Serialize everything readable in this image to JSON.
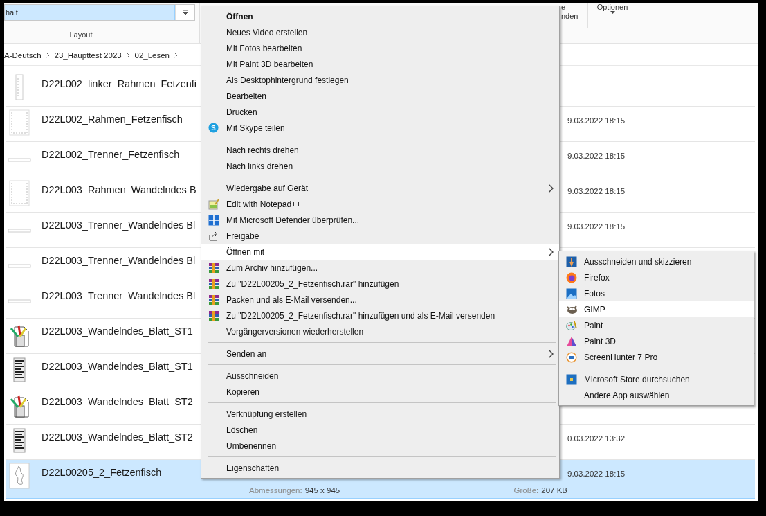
{
  "ribbon": {
    "gallery": {
      "items": [
        {
          "label": "halt",
          "selected": true
        }
      ]
    },
    "group_label": "Layout",
    "partial_button": {
      "lines": [
        "e",
        "nden"
      ]
    },
    "options_button": {
      "label": "Optionen"
    }
  },
  "breadcrumb": [
    "A-Deutsch",
    "23_Haupttest 2023",
    "02_Lesen"
  ],
  "files": [
    {
      "name": "D22L002_linker_Rahmen_Fetzenfi",
      "kind": "frame-tall",
      "selected": false
    },
    {
      "name": "D22L002_Rahmen_Fetzenfisch",
      "date": "9.03.2022 18:15",
      "kind": "frame",
      "selected": false
    },
    {
      "name": "D22L002_Trenner_Fetzenfisch",
      "date": "9.03.2022 18:15",
      "kind": "line",
      "selected": false
    },
    {
      "name": "D22L003_Rahmen_Wandelndes B",
      "date": "9.03.2022 18:15",
      "kind": "frame",
      "selected": false
    },
    {
      "name": "D22L003_Trenner_Wandelndes Bl",
      "date": "9.03.2022 18:15",
      "kind": "line",
      "selected": false
    },
    {
      "name": "D22L003_Trenner_Wandelndes Bl",
      "kind": "line",
      "selected": false
    },
    {
      "name": "D22L003_Trenner_Wandelndes Bl",
      "kind": "line",
      "selected": false
    },
    {
      "name": "D22L003_Wandelndes_Blatt_ST1",
      "kind": "paint",
      "selected": false
    },
    {
      "name": "D22L003_Wandelndes_Blatt_ST1",
      "kind": "doc",
      "selected": false
    },
    {
      "name": "D22L003_Wandelndes_Blatt_ST2",
      "kind": "paint",
      "selected": false
    },
    {
      "name": "D22L003_Wandelndes_Blatt_ST2",
      "date": "0.03.2022 13:32",
      "kind": "doc",
      "selected": false
    },
    {
      "name": "D22L00205_2_Fetzenfisch",
      "date": "9.03.2022 18:15",
      "kind": "figure",
      "selected": true,
      "details": {
        "dimensions_label": "Abmessungen:",
        "dimensions": "945 x 945",
        "size_label": "Größe:",
        "size": "207 KB"
      }
    }
  ],
  "context_menu": {
    "groups": [
      [
        {
          "label": "Öffnen",
          "default": true,
          "highlighted": false
        },
        {
          "label": "Neues Video erstellen",
          "highlighted": false
        },
        {
          "label": "Mit Fotos bearbeiten",
          "highlighted": false
        },
        {
          "label": "Mit Paint 3D bearbeiten",
          "highlighted": false
        },
        {
          "label": "Als Desktophintergrund festlegen",
          "highlighted": false
        },
        {
          "label": "Bearbeiten",
          "highlighted": false
        },
        {
          "label": "Drucken",
          "highlighted": false
        },
        {
          "label": "Mit Skype teilen",
          "kind": "skype",
          "highlighted": false
        }
      ],
      [
        {
          "label": "Nach rechts drehen",
          "highlighted": false
        },
        {
          "label": "Nach links drehen",
          "highlighted": false
        }
      ],
      [
        {
          "label": "Wiedergabe auf Gerät",
          "submenu": true,
          "highlighted": false
        },
        {
          "label": "Edit with Notepad++",
          "kind": "notepad",
          "highlighted": false
        },
        {
          "label": "Mit Microsoft Defender überprüfen...",
          "kind": "defender",
          "highlighted": false
        },
        {
          "label": "Freigabe",
          "kind": "share",
          "highlighted": false
        },
        {
          "label": "Öffnen mit",
          "submenu": true,
          "highlighted": true
        },
        {
          "label": "Zum Archiv hinzufügen...",
          "kind": "archive",
          "highlighted": false
        },
        {
          "label": "Zu \"D22L00205_2_Fetzenfisch.rar\" hinzufügen",
          "kind": "archive",
          "highlighted": false
        },
        {
          "label": "Packen und als E-Mail versenden...",
          "kind": "archive",
          "highlighted": false
        },
        {
          "label": "Zu \"D22L00205_2_Fetzenfisch.rar\" hinzufügen und als E-Mail versenden",
          "kind": "archive",
          "highlighted": false
        },
        {
          "label": "Vorgängerversionen wiederherstellen",
          "highlighted": false
        }
      ],
      [
        {
          "label": "Senden an",
          "submenu": true,
          "highlighted": false
        }
      ],
      [
        {
          "label": "Ausschneiden",
          "highlighted": false
        },
        {
          "label": "Kopieren",
          "highlighted": false
        }
      ],
      [
        {
          "label": "Verknüpfung erstellen",
          "highlighted": false
        },
        {
          "label": "Löschen",
          "highlighted": false
        },
        {
          "label": "Umbenennen",
          "highlighted": false
        }
      ],
      [
        {
          "label": "Eigenschaften",
          "highlighted": false
        }
      ]
    ]
  },
  "open_with_menu": {
    "groups": [
      [
        {
          "label": "Ausschneiden und skizzieren",
          "kind": "snip",
          "highlighted": false
        },
        {
          "label": "Firefox",
          "kind": "firefox",
          "highlighted": false
        },
        {
          "label": "Fotos",
          "kind": "photos",
          "highlighted": false
        },
        {
          "label": "GIMP",
          "kind": "gimp",
          "highlighted": true
        },
        {
          "label": "Paint",
          "kind": "paint",
          "highlighted": false
        },
        {
          "label": "Paint 3D",
          "kind": "paint3d",
          "highlighted": false
        },
        {
          "label": "ScreenHunter 7 Pro",
          "kind": "screenhunter",
          "highlighted": false
        }
      ],
      [
        {
          "label": "Microsoft Store durchsuchen",
          "kind": "store",
          "highlighted": false
        },
        {
          "label": "Andere App auswählen",
          "highlighted": false
        }
      ]
    ]
  }
}
